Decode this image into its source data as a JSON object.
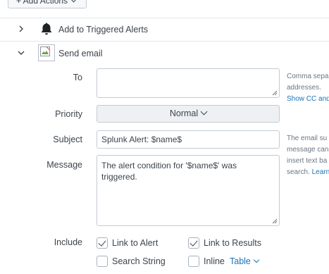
{
  "toolbar": {
    "add_actions_label": "+ Add Actions"
  },
  "actions": [
    {
      "label": "Add to Triggered Alerts",
      "expanded": false,
      "icon": "bell-icon"
    },
    {
      "label": "Send email",
      "expanded": true,
      "icon": "broken-image-icon"
    }
  ],
  "email_form": {
    "to": {
      "label": "To",
      "value": ""
    },
    "to_help": {
      "line1": "Comma sepa",
      "line2": "addresses.",
      "link": "Show CC and"
    },
    "priority": {
      "label": "Priority",
      "value": "Normal"
    },
    "subject": {
      "label": "Subject",
      "value": "Splunk Alert: $name$"
    },
    "subject_help": {
      "line1": "The email su",
      "line2": "message can",
      "line3": "insert text ba",
      "line4_prefix": "search. ",
      "line4_link": "Learn"
    },
    "message": {
      "label": "Message",
      "value": "The alert condition for '$name$' was triggered."
    },
    "include": {
      "label": "Include",
      "options": [
        {
          "label": "Link to Alert",
          "checked": true
        },
        {
          "label": "Link to Results",
          "checked": true
        },
        {
          "label": "Search String",
          "checked": false
        },
        {
          "label": "Inline",
          "checked": false
        }
      ],
      "inline_format": "Table"
    }
  }
}
